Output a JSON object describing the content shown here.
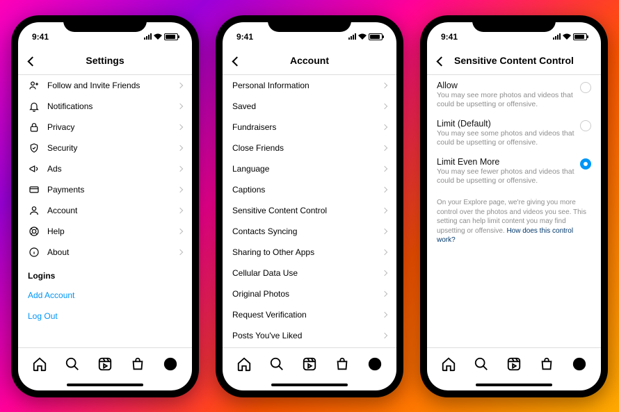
{
  "status": {
    "time": "9:41"
  },
  "phones": [
    {
      "title": "Settings",
      "rows": [
        {
          "icon": "person-plus",
          "label": "Follow and Invite Friends"
        },
        {
          "icon": "bell",
          "label": "Notifications"
        },
        {
          "icon": "lock",
          "label": "Privacy"
        },
        {
          "icon": "shield",
          "label": "Security"
        },
        {
          "icon": "megaphone",
          "label": "Ads"
        },
        {
          "icon": "card",
          "label": "Payments"
        },
        {
          "icon": "user",
          "label": "Account"
        },
        {
          "icon": "lifebuoy",
          "label": "Help"
        },
        {
          "icon": "info",
          "label": "About"
        }
      ],
      "section_label": "Logins",
      "links": [
        "Add Account",
        "Log Out"
      ]
    },
    {
      "title": "Account",
      "rows": [
        {
          "label": "Personal Information"
        },
        {
          "label": "Saved"
        },
        {
          "label": "Fundraisers"
        },
        {
          "label": "Close Friends"
        },
        {
          "label": "Language"
        },
        {
          "label": "Captions"
        },
        {
          "label": "Sensitive Content Control"
        },
        {
          "label": "Contacts Syncing"
        },
        {
          "label": "Sharing to Other Apps"
        },
        {
          "label": "Cellular Data Use"
        },
        {
          "label": "Original Photos"
        },
        {
          "label": "Request Verification"
        },
        {
          "label": "Posts You've Liked"
        }
      ]
    },
    {
      "title": "Sensitive Content Control",
      "options": [
        {
          "title": "Allow",
          "desc": "You may see more photos and videos that could be upsetting or offensive.",
          "selected": false
        },
        {
          "title": "Limit (Default)",
          "desc": "You may see some photos and videos that could be upsetting or offensive.",
          "selected": false
        },
        {
          "title": "Limit Even More",
          "desc": "You may see fewer photos and videos that could be upsetting or offensive.",
          "selected": true
        }
      ],
      "footnote_text": "On your Explore page, we're giving you more control over the photos and videos you see. This setting can help limit content you may find upsetting or offensive. ",
      "footnote_link": "How does this control work?"
    }
  ]
}
